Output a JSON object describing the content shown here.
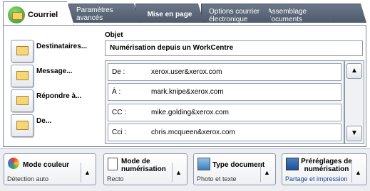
{
  "tabs": [
    {
      "label": "Courriel",
      "icon": "email-icon"
    },
    {
      "label": "Paramètres avancés"
    },
    {
      "label": "Mise en page"
    },
    {
      "label": "Options courrier électronique"
    },
    {
      "label": "Assemblage documents"
    }
  ],
  "sidebar": [
    {
      "label": "Destinataires...",
      "icon": "recipients-icon"
    },
    {
      "label": "Message...",
      "icon": "message-icon"
    },
    {
      "label": "Répondre à...",
      "icon": "reply-icon"
    },
    {
      "label": "De...",
      "icon": "from-icon"
    }
  ],
  "subject": {
    "label": "Objet",
    "value": "Numérisation depuis un WorkCentre"
  },
  "recipients": [
    {
      "key": "De :",
      "value": "xerox.user&xerox.com"
    },
    {
      "key": "À :",
      "value": "mark.knipe&xerox.com"
    },
    {
      "key": "CC :",
      "value": "mike.golding&xerox.com"
    },
    {
      "key": "Cci :",
      "value": "chris.mcqueen&xerox.com"
    }
  ],
  "bottom": [
    {
      "title": "Mode couleur",
      "value": "Détection auto",
      "icon": "color-mode-icon"
    },
    {
      "title": "Mode de numérisation",
      "value": "Recto",
      "icon": "scan-mode-icon"
    },
    {
      "title": "Type document",
      "value": "Photo et texte",
      "icon": "document-type-icon"
    },
    {
      "title": "Préréglages de numérisation",
      "value": "Partage et impression",
      "icon": "scan-presets-icon"
    }
  ],
  "colors": {
    "tab_bg": "#5b6779",
    "accent_link": "#1a3f91"
  }
}
